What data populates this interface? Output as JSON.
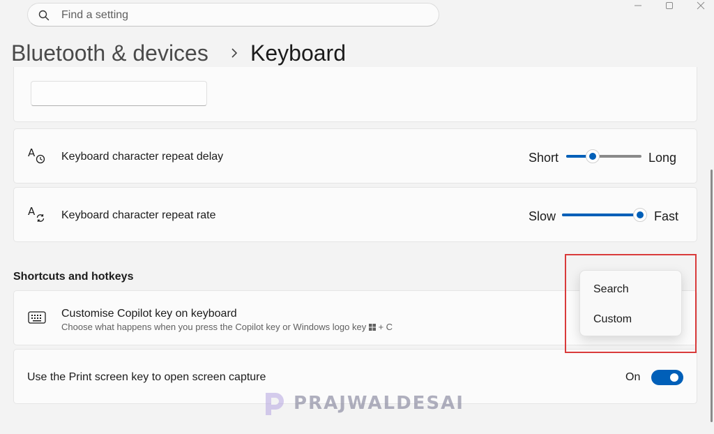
{
  "search": {
    "placeholder": "Find a setting"
  },
  "window_controls": {
    "minimize": "—",
    "maximize": "▢",
    "close": "✕"
  },
  "breadcrumb": {
    "parent": "Bluetooth & devices",
    "current": "Keyboard"
  },
  "repeat_delay": {
    "label": "Keyboard character repeat delay",
    "min_label": "Short",
    "max_label": "Long",
    "value_fraction": 0.35
  },
  "repeat_rate": {
    "label": "Keyboard character repeat rate",
    "min_label": "Slow",
    "max_label": "Fast",
    "value_fraction": 1.0
  },
  "shortcuts": {
    "section_title": "Shortcuts and hotkeys"
  },
  "copilot": {
    "label": "Customise Copilot key on keyboard",
    "description_prefix": "Choose what happens when you press the Copilot key or Windows logo key",
    "description_suffix": "+ C"
  },
  "flyout": {
    "items": [
      "Search",
      "Custom"
    ]
  },
  "print_screen": {
    "label": "Use the Print screen key to open screen capture",
    "state": "On"
  },
  "watermark": {
    "text": "PRAJWALDESAI"
  },
  "colors": {
    "accent": "#005fb8",
    "highlight_box": "#d93a3a"
  }
}
